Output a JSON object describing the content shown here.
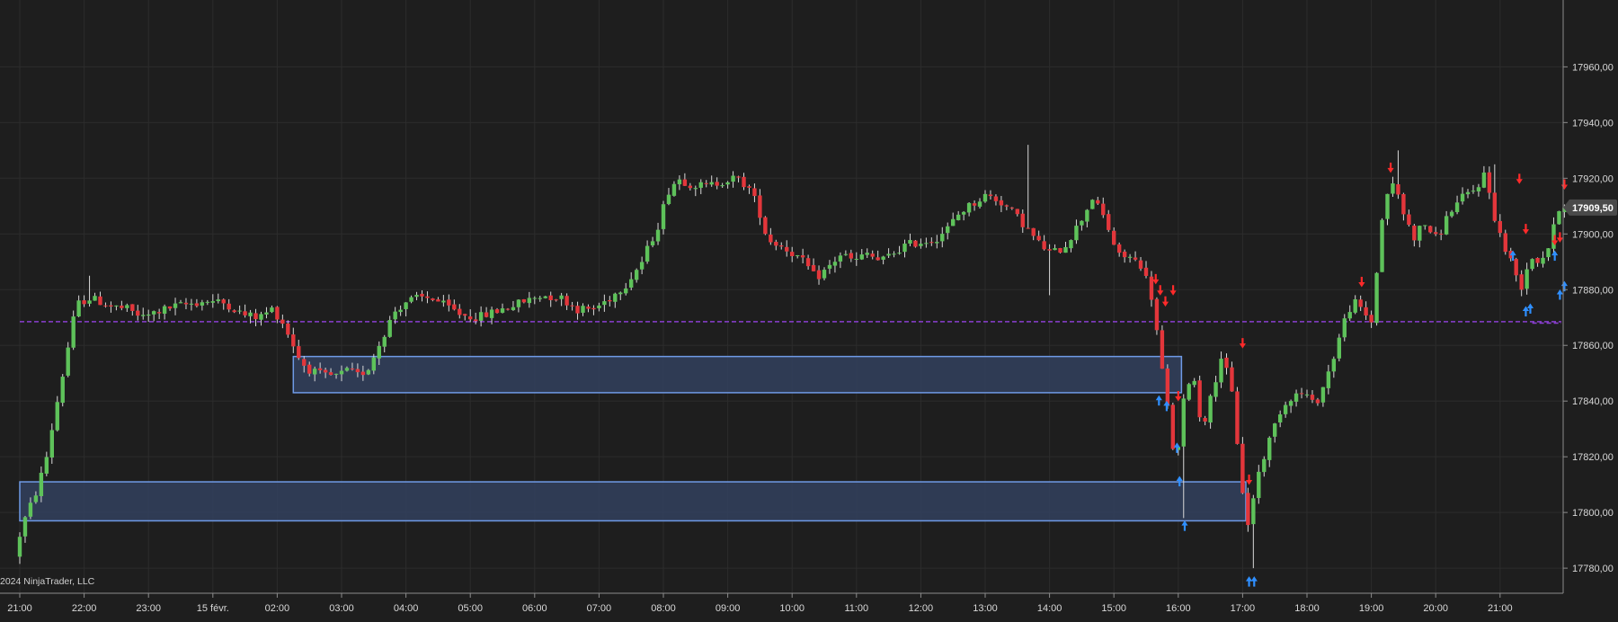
{
  "copyright": "2024 NinjaTrader, LLC",
  "chart_data": {
    "type": "candlestick",
    "ylim": [
      17771,
      17984
    ],
    "yticks": [
      17780,
      17800,
      17820,
      17840,
      17860,
      17880,
      17900,
      17920,
      17940,
      17960
    ],
    "ytick_labels": [
      "17780,00",
      "17800,00",
      "17820,00",
      "17840,00",
      "17860,00",
      "17880,00",
      "17900,00",
      "17920,00",
      "17940,00",
      "17960,00"
    ],
    "xticks": [
      "21:00",
      "22:00",
      "23:00",
      "15 févr.",
      "02:00",
      "03:00",
      "04:00",
      "05:00",
      "06:00",
      "07:00",
      "08:00",
      "09:00",
      "10:00",
      "11:00",
      "12:00",
      "13:00",
      "14:00",
      "15:00",
      "16:00",
      "17:00",
      "18:00",
      "19:00",
      "20:00",
      "21:00"
    ],
    "current_price": 17909.5,
    "current_price_label": "17909,50",
    "levels": [
      {
        "price": 17868.5,
        "start_hour": 0.0,
        "end_hour": 24.0,
        "color": "#8a3fd1",
        "style": "dashed"
      },
      {
        "price": 17868.0,
        "start_hour": 23.5,
        "end_hour": 24.0,
        "color": "#8a3fd1",
        "style": "dashed"
      }
    ],
    "zones": [
      {
        "start_hour": 4.25,
        "end_hour": 18.05,
        "top": 17856,
        "bottom": 17843
      },
      {
        "start_hour": 0.0,
        "end_hour": 19.05,
        "top": 17811,
        "bottom": 17797
      }
    ],
    "anchors": [
      [
        0.0,
        17786
      ],
      [
        0.17,
        17798
      ],
      [
        0.35,
        17808
      ],
      [
        0.5,
        17820
      ],
      [
        0.65,
        17838
      ],
      [
        0.8,
        17855
      ],
      [
        0.9,
        17868
      ],
      [
        1.0,
        17875
      ],
      [
        1.15,
        17877
      ],
      [
        1.3,
        17876
      ],
      [
        1.5,
        17874
      ],
      [
        1.75,
        17873
      ],
      [
        2.0,
        17870
      ],
      [
        2.2,
        17872
      ],
      [
        2.5,
        17874
      ],
      [
        3.0,
        17876
      ],
      [
        3.3,
        17875
      ],
      [
        3.55,
        17871
      ],
      [
        3.8,
        17870
      ],
      [
        4.0,
        17873
      ],
      [
        4.15,
        17869
      ],
      [
        4.3,
        17862
      ],
      [
        4.45,
        17854
      ],
      [
        4.6,
        17851
      ],
      [
        4.8,
        17849
      ],
      [
        5.0,
        17849
      ],
      [
        5.2,
        17851
      ],
      [
        5.35,
        17849
      ],
      [
        5.5,
        17852
      ],
      [
        5.7,
        17862
      ],
      [
        5.9,
        17872
      ],
      [
        6.1,
        17876
      ],
      [
        6.3,
        17877
      ],
      [
        6.5,
        17877
      ],
      [
        6.7,
        17874
      ],
      [
        6.95,
        17871
      ],
      [
        7.2,
        17870
      ],
      [
        7.45,
        17872
      ],
      [
        7.7,
        17874
      ],
      [
        7.95,
        17876
      ],
      [
        8.2,
        17878
      ],
      [
        8.5,
        17877
      ],
      [
        8.75,
        17873
      ],
      [
        9.0,
        17873
      ],
      [
        9.25,
        17877
      ],
      [
        9.5,
        17882
      ],
      [
        9.75,
        17890
      ],
      [
        10.0,
        17903
      ],
      [
        10.15,
        17915
      ],
      [
        10.3,
        17920
      ],
      [
        10.5,
        17918
      ],
      [
        10.75,
        17917
      ],
      [
        11.0,
        17919
      ],
      [
        11.2,
        17920
      ],
      [
        11.4,
        17917
      ],
      [
        11.55,
        17910
      ],
      [
        11.7,
        17898
      ],
      [
        11.9,
        17896
      ],
      [
        12.1,
        17893
      ],
      [
        12.3,
        17889
      ],
      [
        12.45,
        17884
      ],
      [
        12.65,
        17888
      ],
      [
        12.85,
        17893
      ],
      [
        13.05,
        17890
      ],
      [
        13.25,
        17893
      ],
      [
        13.45,
        17890
      ],
      [
        13.65,
        17893
      ],
      [
        13.85,
        17896
      ],
      [
        14.05,
        17897
      ],
      [
        14.3,
        17898
      ],
      [
        14.5,
        17902
      ],
      [
        14.7,
        17908
      ],
      [
        14.9,
        17911
      ],
      [
        15.1,
        17914
      ],
      [
        15.3,
        17912
      ],
      [
        15.5,
        17908
      ],
      [
        15.7,
        17903
      ],
      [
        15.9,
        17897
      ],
      [
        16.1,
        17893
      ],
      [
        16.3,
        17895
      ],
      [
        16.55,
        17904
      ],
      [
        16.75,
        17913
      ],
      [
        16.95,
        17905
      ],
      [
        17.15,
        17892
      ],
      [
        17.3,
        17892
      ],
      [
        17.5,
        17889
      ],
      [
        17.65,
        17880
      ],
      [
        17.75,
        17865
      ],
      [
        17.85,
        17848
      ],
      [
        17.95,
        17832
      ],
      [
        18.05,
        17815
      ],
      [
        18.15,
        17838
      ],
      [
        18.3,
        17852
      ],
      [
        18.45,
        17830
      ],
      [
        18.6,
        17842
      ],
      [
        18.75,
        17856
      ],
      [
        18.9,
        17846
      ],
      [
        19.05,
        17815
      ],
      [
        19.15,
        17793
      ],
      [
        19.3,
        17812
      ],
      [
        19.5,
        17826
      ],
      [
        19.65,
        17836
      ],
      [
        19.85,
        17842
      ],
      [
        20.05,
        17843
      ],
      [
        20.2,
        17838
      ],
      [
        20.35,
        17846
      ],
      [
        20.5,
        17856
      ],
      [
        20.65,
        17868
      ],
      [
        20.8,
        17876
      ],
      [
        20.95,
        17872
      ],
      [
        21.1,
        17868
      ],
      [
        21.2,
        17896
      ],
      [
        21.3,
        17914
      ],
      [
        21.45,
        17918
      ],
      [
        21.6,
        17906
      ],
      [
        21.75,
        17899
      ],
      [
        21.9,
        17904
      ],
      [
        22.1,
        17898
      ],
      [
        22.3,
        17908
      ],
      [
        22.5,
        17913
      ],
      [
        22.7,
        17916
      ],
      [
        22.85,
        17922
      ],
      [
        23.0,
        17906
      ],
      [
        23.15,
        17895
      ],
      [
        23.3,
        17888
      ],
      [
        23.4,
        17880
      ],
      [
        23.55,
        17892
      ],
      [
        23.7,
        17890
      ],
      [
        23.85,
        17896
      ],
      [
        24.0,
        17909.5
      ]
    ],
    "spikes": [
      {
        "hour": 1.05,
        "high": 17885
      },
      {
        "hour": 15.7,
        "high": 17932
      },
      {
        "hour": 16.0,
        "low": 17878
      },
      {
        "hour": 18.05,
        "low": 17798
      },
      {
        "hour": 19.15,
        "low": 17780
      },
      {
        "hour": 21.45,
        "high": 17930
      },
      {
        "hour": 22.95,
        "high": 17925
      }
    ],
    "signals_down": [
      {
        "hour": 17.65,
        "price": 17884
      },
      {
        "hour": 17.72,
        "price": 17880
      },
      {
        "hour": 17.8,
        "price": 17876
      },
      {
        "hour": 17.92,
        "price": 17880
      },
      {
        "hour": 18.0,
        "price": 17842
      },
      {
        "hour": 19.0,
        "price": 17861
      },
      {
        "hour": 19.1,
        "price": 17812
      },
      {
        "hour": 20.85,
        "price": 17883
      },
      {
        "hour": 21.3,
        "price": 17924
      },
      {
        "hour": 23.3,
        "price": 17920
      },
      {
        "hour": 23.4,
        "price": 17902
      },
      {
        "hour": 23.85,
        "price": 17898
      },
      {
        "hour": 23.93,
        "price": 17899
      },
      {
        "hour": 24.0,
        "price": 17918
      }
    ],
    "signals_up": [
      {
        "hour": 17.7,
        "price": 17840
      },
      {
        "hour": 17.82,
        "price": 17838
      },
      {
        "hour": 17.98,
        "price": 17823
      },
      {
        "hour": 18.02,
        "price": 17811
      },
      {
        "hour": 18.1,
        "price": 17795
      },
      {
        "hour": 19.1,
        "price": 17775
      },
      {
        "hour": 19.18,
        "price": 17775
      },
      {
        "hour": 23.2,
        "price": 17892
      },
      {
        "hour": 23.4,
        "price": 17872
      },
      {
        "hour": 23.47,
        "price": 17873
      },
      {
        "hour": 23.85,
        "price": 17892
      },
      {
        "hour": 23.93,
        "price": 17878
      },
      {
        "hour": 24.0,
        "price": 17881
      }
    ]
  },
  "colors": {
    "background": "#1e1e1e",
    "grid": "#2c2c2c",
    "bull": "#5ec25a",
    "bear": "#e3363b",
    "wick": "#d9d9d9",
    "zone_fill": "#33415e",
    "zone_stroke": "#6f9ae6",
    "signal_down": "#ff2a2a",
    "signal_up": "#2f8fff",
    "level": "#8a3fd1",
    "axis_line": "#8c8c8c",
    "price_label_bg": "#4a4a4a"
  }
}
